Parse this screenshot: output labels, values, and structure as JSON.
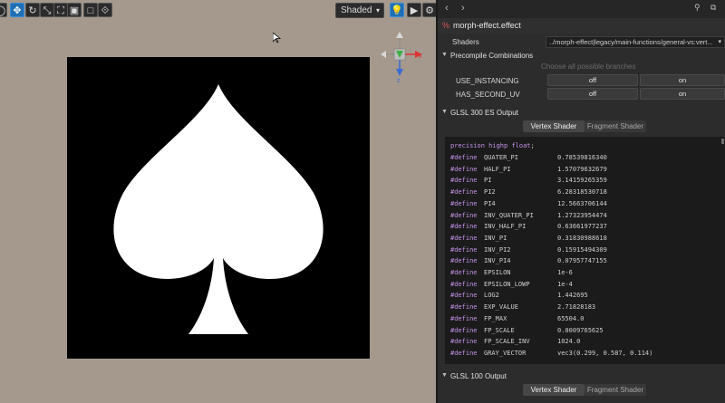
{
  "scene": {
    "shading_mode": "Shaded",
    "toolbar_icons": [
      "select-icon",
      "move-icon",
      "rotate-icon",
      "scale-icon",
      "rect-icon",
      "rect-tool-icon",
      "global-icon",
      "light-icon",
      "camera-icon",
      "gear-icon"
    ]
  },
  "panel": {
    "nav": {
      "back": "‹",
      "forward": "›",
      "pin": "⚲",
      "copy": "⧉"
    },
    "title": "morph-effect.effect",
    "shaders": {
      "label": "Shaders",
      "value": "../morph-effect|legacy/main-functions/general-vs:vert..."
    },
    "precompile": {
      "header": "Precompile Combinations",
      "hint": "Choose all possible branches",
      "rows": [
        {
          "label": "USE_INSTANCING",
          "off": "off",
          "on": "on"
        },
        {
          "label": "HAS_SECOND_UV",
          "off": "off",
          "on": "on"
        }
      ]
    },
    "glsl300": {
      "header": "GLSL 300 ES Output",
      "tabs": [
        "Vertex Shader",
        "Fragment Shader"
      ],
      "first_line": {
        "kw": "precision highp ",
        "type": "float",
        "end": ";"
      },
      "defines": [
        {
          "d": "#define",
          "name": "QUATER_PI",
          "val": "0.78539816340"
        },
        {
          "d": "#define",
          "name": "HALF_PI",
          "val": "1.57079632679"
        },
        {
          "d": "#define",
          "name": "PI",
          "val": "3.14159265359"
        },
        {
          "d": "#define",
          "name": "PI2",
          "val": "6.28318530718"
        },
        {
          "d": "#define",
          "name": "PI4",
          "val": "12.5663706144"
        },
        {
          "d": "#define",
          "name": "INV_QUATER_PI",
          "val": "1.27323954474"
        },
        {
          "d": "#define",
          "name": "INV_HALF_PI",
          "val": "0.63661977237"
        },
        {
          "d": "#define",
          "name": "INV_PI",
          "val": "0.31830988618"
        },
        {
          "d": "#define",
          "name": "INV_PI2",
          "val": "0.15915494309"
        },
        {
          "d": "#define",
          "name": "INV_PI4",
          "val": "0.07957747155"
        },
        {
          "d": "#define",
          "name": "EPSILON",
          "val": "1e-6"
        },
        {
          "d": "#define",
          "name": "EPSILON_LOWP",
          "val": "1e-4"
        },
        {
          "d": "#define",
          "name": "LOG2",
          "val": "1.442695"
        },
        {
          "d": "#define",
          "name": "EXP_VALUE",
          "val": "2.71828183"
        },
        {
          "d": "#define",
          "name": "FP_MAX",
          "val": "65504.0"
        },
        {
          "d": "#define",
          "name": "FP_SCALE",
          "val": "0.0009765625"
        },
        {
          "d": "#define",
          "name": "FP_SCALE_INV",
          "val": "1024.0"
        },
        {
          "d": "#define",
          "name": "GRAY_VECTOR",
          "val": "vec3(0.299, 0.587, 0.114)"
        }
      ]
    },
    "glsl100": {
      "header": "GLSL 100 Output",
      "tabs": [
        "Vertex Shader",
        "Fragment Shader"
      ]
    }
  }
}
